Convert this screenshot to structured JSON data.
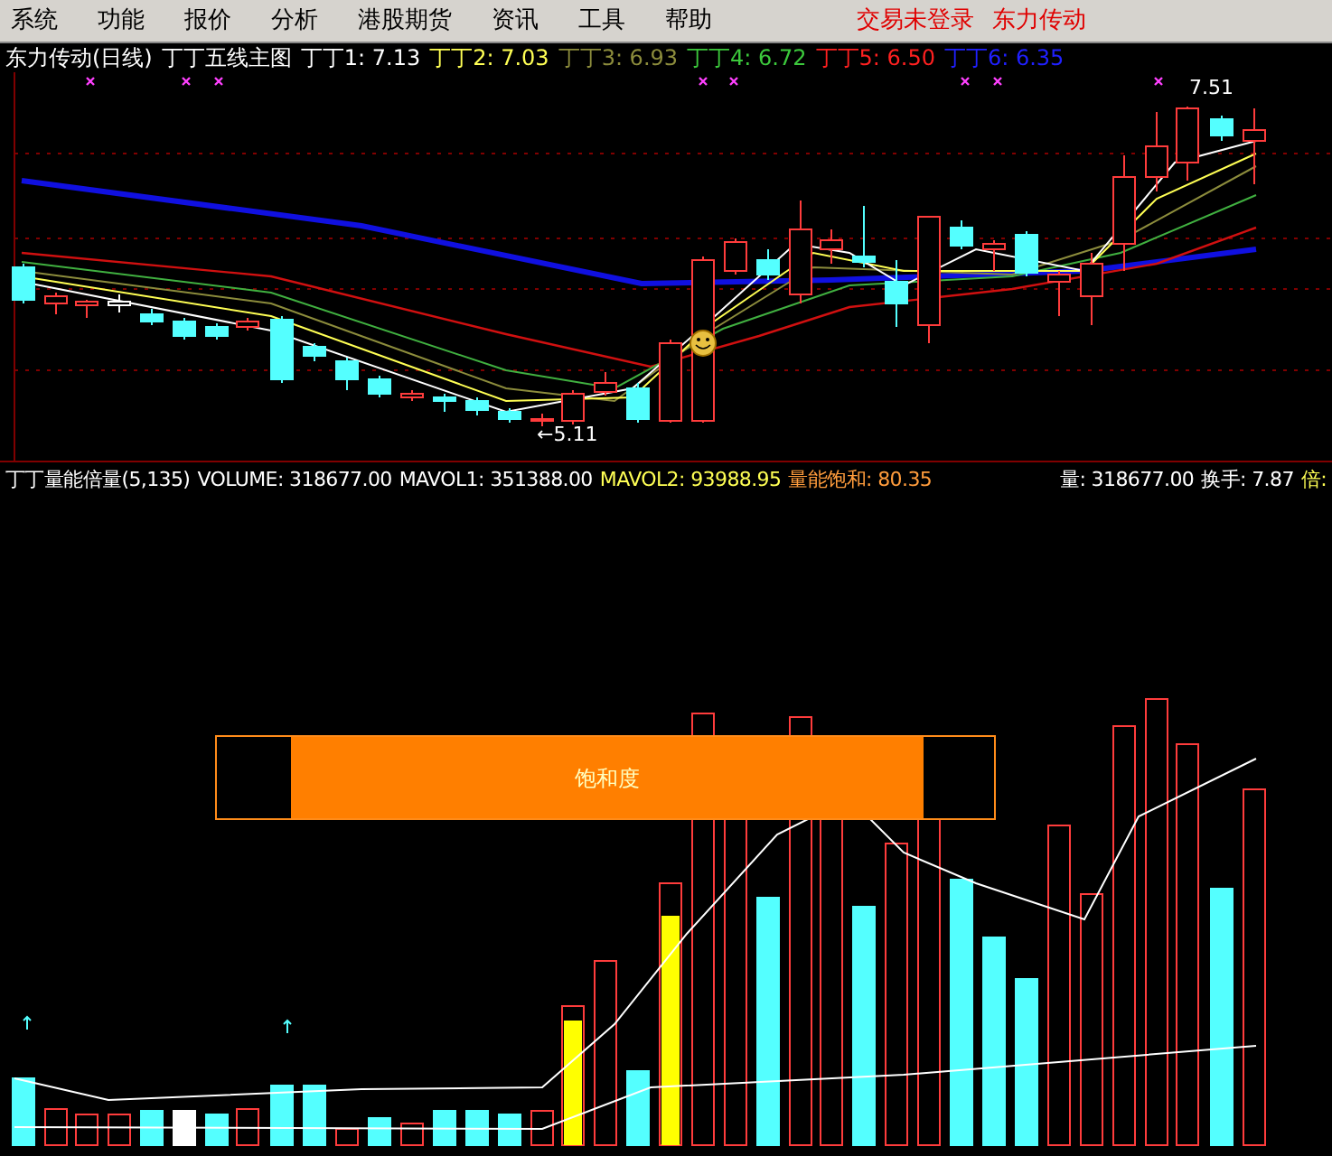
{
  "menu": [
    "系统",
    "功能",
    "报价",
    "分析",
    "港股期货",
    "资讯",
    "工具",
    "帮助"
  ],
  "status": [
    "交易未登录",
    "东力传动"
  ],
  "main_chart": {
    "title": "东力传动(日线)",
    "indicator": "丁丁五线主图",
    "lines": [
      {
        "label": "丁丁1: 7.13",
        "color": "#ffffff"
      },
      {
        "label": "丁丁2: 7.03",
        "color": "#ffff54"
      },
      {
        "label": "丁丁3: 6.93",
        "color": "#8c8c3c"
      },
      {
        "label": "丁丁4: 6.72",
        "color": "#3cc83c"
      },
      {
        "label": "丁丁5: 6.50",
        "color": "#ff2020"
      },
      {
        "label": "丁丁6: 6.35",
        "color": "#2020ff"
      }
    ],
    "low_label": "←5.11",
    "high_label": "7.51"
  },
  "volume_pane": {
    "title": "丁丁量能倍量(5,135)",
    "readouts": [
      {
        "label": "VOLUME: 318677.00",
        "color": "#ffffff"
      },
      {
        "label": "MAVOL1: 351388.00",
        "color": "#ffffff"
      },
      {
        "label": "MAVOL2: 93988.95",
        "color": "#ffff54"
      },
      {
        "label": "量能饱和: 80.35",
        "color": "#ff9c3c"
      }
    ],
    "right_readouts": [
      {
        "label": "量: 318677.00",
        "color": "#ffffff"
      },
      {
        "label": "换手: 7.87",
        "color": "#ffffff"
      },
      {
        "label": "倍:",
        "color": "#ffff54"
      }
    ],
    "saturation_label": "饱和度"
  }
}
